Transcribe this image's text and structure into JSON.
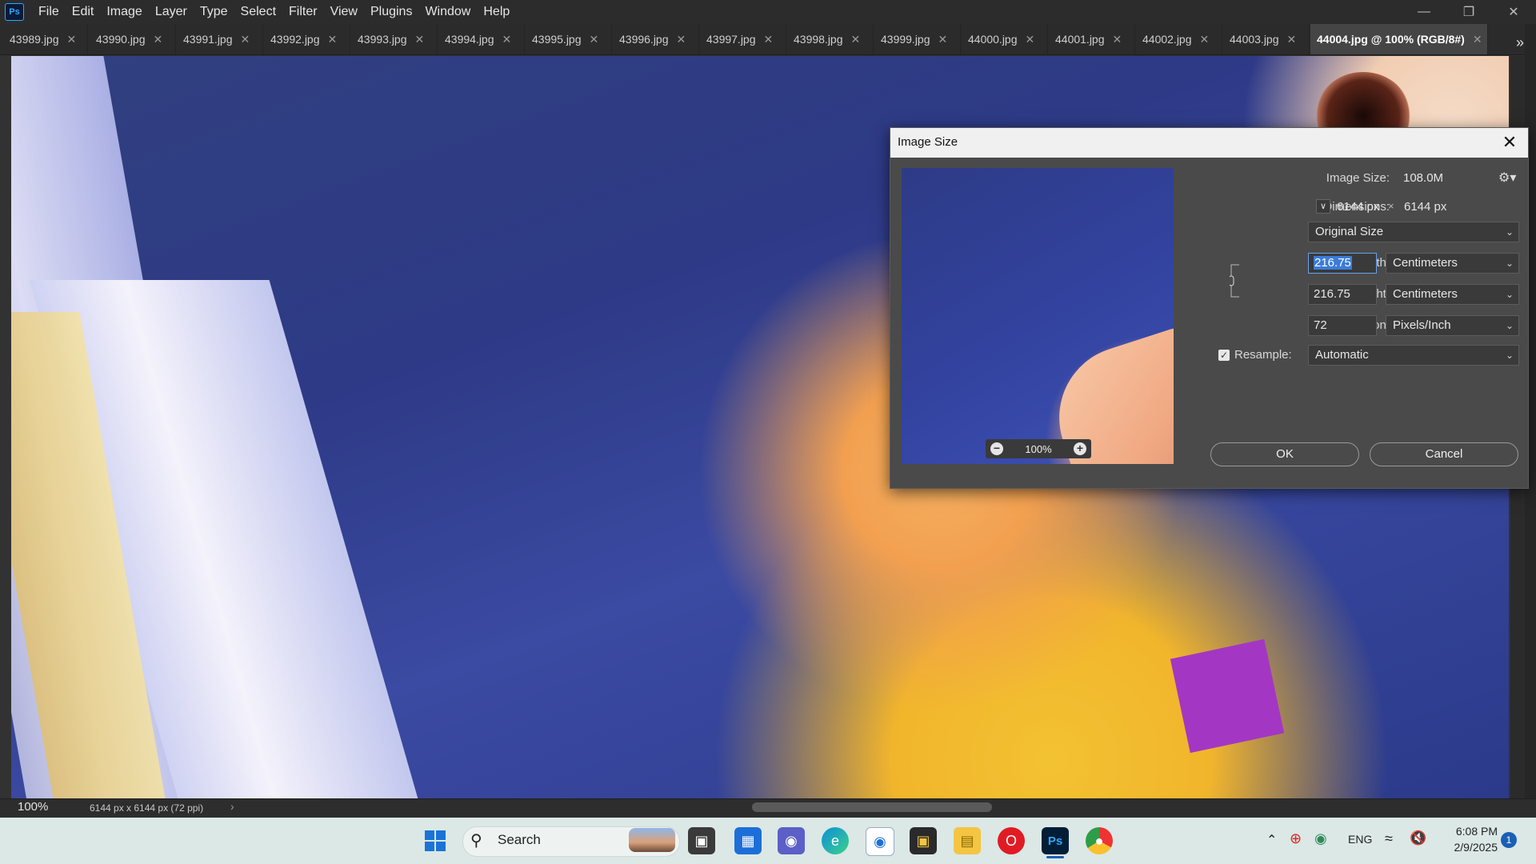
{
  "app": {
    "logo": "Ps"
  },
  "menu": [
    "File",
    "Edit",
    "Image",
    "Layer",
    "Type",
    "Select",
    "Filter",
    "View",
    "Plugins",
    "Window",
    "Help"
  ],
  "tabs": [
    {
      "label": "43989.jpg"
    },
    {
      "label": "43990.jpg"
    },
    {
      "label": "43991.jpg"
    },
    {
      "label": "43992.jpg"
    },
    {
      "label": "43993.jpg"
    },
    {
      "label": "43994.jpg"
    },
    {
      "label": "43995.jpg"
    },
    {
      "label": "43996.jpg"
    },
    {
      "label": "43997.jpg"
    },
    {
      "label": "43998.jpg"
    },
    {
      "label": "43999.jpg"
    },
    {
      "label": "44000.jpg"
    },
    {
      "label": "44001.jpg"
    },
    {
      "label": "44002.jpg"
    },
    {
      "label": "44003.jpg"
    },
    {
      "label": "44004.jpg @ 100% (RGB/8#)",
      "active": true
    }
  ],
  "status": {
    "zoom": "100%",
    "doc_info": "6144 px x 6144 px (72 ppi)"
  },
  "dialog": {
    "title": "Image Size",
    "preview_zoom": "100%",
    "image_size_label": "Image Size:",
    "image_size_value": "108.0M",
    "dimensions_label": "Dimensions:",
    "dim_w": "6144 px",
    "dim_x": "×",
    "dim_h": "6144 px",
    "fit_label": "Fit T...",
    "fit_value": "Original Size",
    "width_label": "Width:",
    "width_value": "216.75",
    "width_unit": "Centimeters",
    "height_label": "Height:",
    "height_value": "216.75",
    "height_unit": "Centimeters",
    "resolution_label": "Resolution:",
    "resolution_value": "72",
    "resolution_unit": "Pixels/Inch",
    "resample_label": "Resample:",
    "resample_checked": true,
    "resample_value": "Automatic",
    "ok": "OK",
    "cancel": "Cancel"
  },
  "taskbar": {
    "search": "Search",
    "language": "ENG",
    "time": "6:08 PM",
    "date": "2/9/2025",
    "notifications": "1"
  },
  "colors": {
    "accent": "#31a8ff",
    "selection": "#3b7cd8",
    "taskbar": "#dbe8e6"
  }
}
